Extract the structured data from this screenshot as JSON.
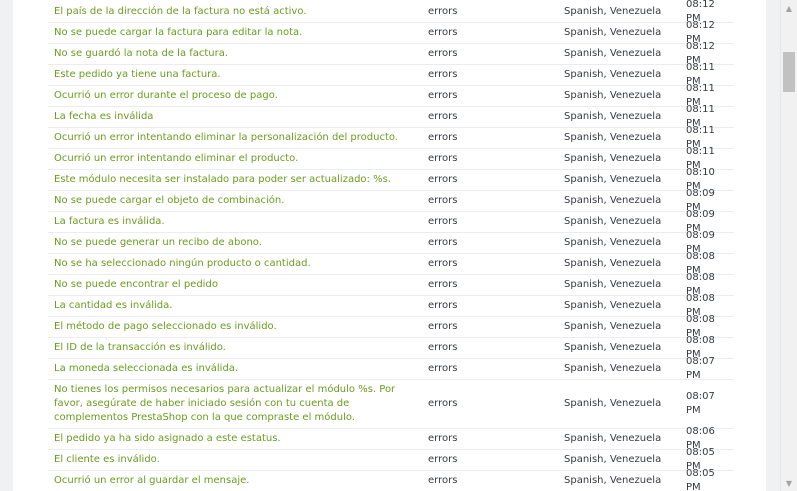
{
  "rows": [
    {
      "message": "El país de la dirección de la factura no está activo.",
      "domain": "errors",
      "language": "Spanish, Venezuela",
      "time": "08:12 PM"
    },
    {
      "message": "No se puede cargar la factura para editar la nota.",
      "domain": "errors",
      "language": "Spanish, Venezuela",
      "time": "08:12 PM"
    },
    {
      "message": "No se guardó la nota de la factura.",
      "domain": "errors",
      "language": "Spanish, Venezuela",
      "time": "08:12 PM"
    },
    {
      "message": "Este pedido ya tiene una factura.",
      "domain": "errors",
      "language": "Spanish, Venezuela",
      "time": "08:11 PM"
    },
    {
      "message": "Ocurrió un error durante el proceso de pago.",
      "domain": "errors",
      "language": "Spanish, Venezuela",
      "time": "08:11 PM"
    },
    {
      "message": "La fecha es inválida",
      "domain": "errors",
      "language": "Spanish, Venezuela",
      "time": "08:11 PM"
    },
    {
      "message": "Ocurrió un error intentando eliminar la personalización del producto.",
      "domain": "errors",
      "language": "Spanish, Venezuela",
      "time": "08:11 PM"
    },
    {
      "message": "Ocurrió un error intentando eliminar el producto.",
      "domain": "errors",
      "language": "Spanish, Venezuela",
      "time": "08:11 PM"
    },
    {
      "message": "Este módulo necesita ser instalado para poder ser actualizado: %s.",
      "domain": "errors",
      "language": "Spanish, Venezuela",
      "time": "08:10 PM"
    },
    {
      "message": "No se puede cargar el objeto de combinación.",
      "domain": "errors",
      "language": "Spanish, Venezuela",
      "time": "08:09 PM"
    },
    {
      "message": "La factura es inválida.",
      "domain": "errors",
      "language": "Spanish, Venezuela",
      "time": "08:09 PM"
    },
    {
      "message": "No se puede generar un recibo de abono.",
      "domain": "errors",
      "language": "Spanish, Venezuela",
      "time": "08:09 PM"
    },
    {
      "message": "No se ha seleccionado ningún producto o cantidad.",
      "domain": "errors",
      "language": "Spanish, Venezuela",
      "time": "08:08 PM"
    },
    {
      "message": "No se puede encontrar el pedido",
      "domain": "errors",
      "language": "Spanish, Venezuela",
      "time": "08:08 PM"
    },
    {
      "message": "La cantidad es inválida.",
      "domain": "errors",
      "language": "Spanish, Venezuela",
      "time": "08:08 PM"
    },
    {
      "message": "El método de pago seleccionado es inválido.",
      "domain": "errors",
      "language": "Spanish, Venezuela",
      "time": "08:08 PM"
    },
    {
      "message": "El ID de la transacción es inválido.",
      "domain": "errors",
      "language": "Spanish, Venezuela",
      "time": "08:08 PM"
    },
    {
      "message": "La moneda seleccionada es inválida.",
      "domain": "errors",
      "language": "Spanish, Venezuela",
      "time": "08:07 PM"
    },
    {
      "message": "No tienes los permisos necesarios para actualizar el módulo %s. Por favor, asegúrate de haber iniciado sesión con tu cuenta de complementos PrestaShop con la que compraste el módulo.",
      "domain": "errors",
      "language": "Spanish, Venezuela",
      "time": "08:07 PM",
      "tall": true
    },
    {
      "message": "El pedido ya ha sido asignado a este estatus.",
      "domain": "errors",
      "language": "Spanish, Venezuela",
      "time": "08:06 PM"
    },
    {
      "message": "El cliente es inválido.",
      "domain": "errors",
      "language": "Spanish, Venezuela",
      "time": "08:05 PM"
    },
    {
      "message": "Ocurrió un error al guardar el mensaje.",
      "domain": "errors",
      "language": "Spanish, Venezuela",
      "time": "08:05 PM"
    }
  ],
  "colors": {
    "message": "#6c9a1f",
    "text": "#363a41",
    "divider": "#eaedef"
  },
  "icons": {
    "scroll_up": "triangle-up",
    "scroll_down": "triangle-down"
  }
}
